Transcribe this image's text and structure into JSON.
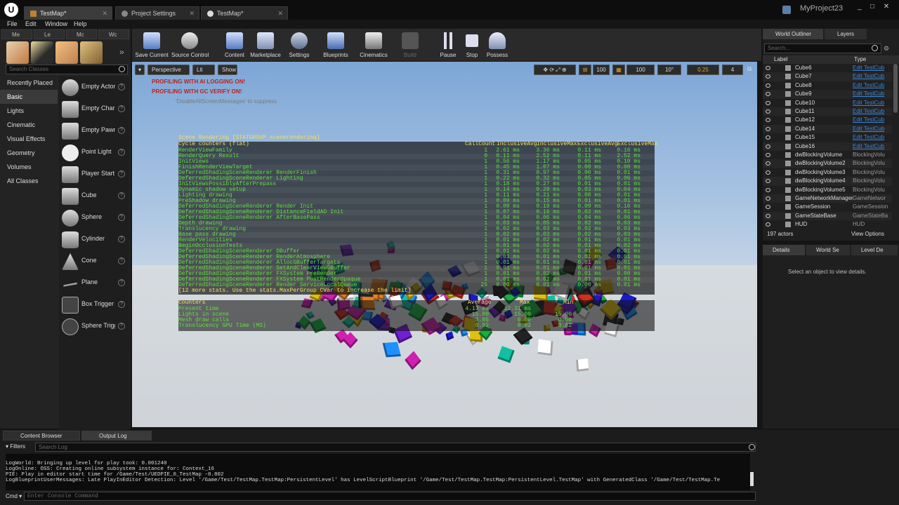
{
  "window": {
    "logo": "U",
    "tabs": [
      "TestMap*",
      "Project Settings",
      "TestMap*"
    ],
    "project_name": "MyProject23",
    "controls": [
      "_",
      "□",
      "✕"
    ]
  },
  "menu": [
    "File",
    "Edit",
    "Window",
    "Help"
  ],
  "modes": {
    "tabs": [
      "Me",
      "Le",
      "Mc",
      "Wc"
    ],
    "search_placeholder": "Search Classes",
    "categories": [
      "Recently Placed",
      "Basic",
      "Lights",
      "Cinematic",
      "Visual Effects",
      "Geometry",
      "Volumes",
      "All Classes"
    ],
    "actors": [
      "Empty Actor",
      "Empty Chara",
      "Empty Pawn",
      "Point Light",
      "Player Start",
      "Cube",
      "Sphere",
      "Cylinder",
      "Cone",
      "Plane",
      "Box Trigger",
      "Sphere Trigg"
    ]
  },
  "toolbar": {
    "buttons": [
      "Save Current",
      "Source Control",
      "Content",
      "Marketplace",
      "Settings",
      "Blueprints",
      "Cinematics",
      "Build",
      "Pause",
      "Stop",
      "Possess"
    ]
  },
  "viewport": {
    "perspective": "Perspective",
    "lit": "Lit",
    "show": "Show",
    "snap_values": [
      "100",
      "100",
      "10°",
      "0.25",
      "4"
    ],
    "warnings": [
      "PROFILING WITH AI LOGGING ON!",
      "PROFILING WITH GC VERIFY ON!"
    ],
    "hint": "'DisableAllScreenMessages' to suppress",
    "stats": {
      "group_title": "Scene Rendering [STATGROUP_scenerendering]",
      "section": "Cycle counters (flat)",
      "columns": [
        "CallCount",
        "InclusiveAvg",
        "InclusiveMax",
        "ExclusiveAvg",
        "ExclusiveMax"
      ],
      "rows": [
        [
          "RenderViewFamily",
          "1",
          "2.61 ms",
          "3.36 ms",
          "0.11 ms",
          "0.16 ms"
        ],
        [
          "RenderQuery Result",
          "0",
          "0.11 ms",
          "2.52 ms",
          "0.11 ms",
          "2.52 ms"
        ],
        [
          "InitViews",
          "1",
          "0.56 ms",
          "1.17 ms",
          "0.05 ms",
          "0.10 ms"
        ],
        [
          "FinishRenderViewTarget",
          "1",
          "0.45 ms",
          "1.07 ms",
          "0.00 ms",
          "0.00 ms"
        ],
        [
          "DeferredShadingSceneRenderer RenderFinish",
          "1",
          "0.31 ms",
          "0.97 ms",
          "0.00 ms",
          "0.01 ms"
        ],
        [
          "DeferredShadingSceneRenderer Lighting",
          "1",
          "0.22 ms",
          "0.32 ms",
          "0.05 ms",
          "0.06 ms"
        ],
        [
          "InitViewsPossiblyAfterPrepass",
          "1",
          "0.18 ms",
          "0.27 ms",
          "0.01 ms",
          "0.01 ms"
        ],
        [
          "Dynamic shadow setup",
          "1",
          "0.14 ms",
          "0.29 ms",
          "0.03 ms",
          "0.04 ms"
        ],
        [
          "Lighting drawing",
          "1",
          "0.11 ms",
          "0.21 ms",
          "0.00 ms",
          "0.01 ms"
        ],
        [
          "PreShadow drawing",
          "1",
          "0.09 ms",
          "0.15 ms",
          "0.01 ms",
          "0.01 ms"
        ],
        [
          "DeferredShadingSceneRenderer Render Init",
          "1",
          "0.09 ms",
          "0.19 ms",
          "0.09 ms",
          "0.16 ms"
        ],
        [
          "DeferredShadingSceneRenderer DistanceFieldAO Init",
          "1",
          "0.07 ms",
          "0.16 ms",
          "0.02 ms",
          "0.01 ms"
        ],
        [
          "DeferredShadingSceneRenderer AfterBasePass",
          "1",
          "0.04 ms",
          "0.06 ms",
          "0.04 ms",
          "0.06 ms"
        ],
        [
          "Depth drawing",
          "1",
          "0.03 ms",
          "0.05 ms",
          "0.02 ms",
          "0.03 ms"
        ],
        [
          "Translucency drawing",
          "1",
          "0.02 ms",
          "0.03 ms",
          "0.02 ms",
          "0.03 ms"
        ],
        [
          "Base pass drawing",
          "1",
          "0.02 ms",
          "0.03 ms",
          "0.02 ms",
          "0.03 ms"
        ],
        [
          "RenderVelocities",
          "1",
          "0.01 ms",
          "0.02 ms",
          "0.01 ms",
          "0.01 ms"
        ],
        [
          "BeginOcclusionTests",
          "1",
          "0.01 ms",
          "0.02 ms",
          "0.01 ms",
          "0.02 ms"
        ],
        [
          "DeferredShadingSceneRenderer DBuffer",
          "1",
          "0.01 ms",
          "0.02 ms",
          "0.01 ms",
          "0.01 ms"
        ],
        [
          "DeferredShadingSceneRenderer RenderAtmosphere",
          "1",
          "0.01 ms",
          "0.01 ms",
          "0.01 ms",
          "0.01 ms"
        ],
        [
          "DeferredShadingSceneRenderer AllocGBufferTargets",
          "1",
          "0.01 ms",
          "0.01 ms",
          "0.01 ms",
          "0.01 ms"
        ],
        [
          "DeferredShadingSceneRenderer SetAndClearViewGBuffer",
          "1",
          "0.01 ms",
          "0.01 ms",
          "0.01 ms",
          "0.01 ms"
        ],
        [
          "DeferredShadingSceneRenderer FXSystem PreRender",
          "1",
          "0.01 ms",
          "0.02 ms",
          "0.01 ms",
          "0.00 ms"
        ],
        [
          "DeferredShadingSceneRenderer FXSystem PostRenderOpaque",
          "1",
          "0.01 ms",
          "0.01 ms",
          "0.01 ms",
          "0.01 ms"
        ],
        [
          "DeferredShadingSceneRenderer Render ServiceLocalQueue",
          "25",
          "0.00 ms",
          "0.01 ms",
          "0.00 ms",
          "0.01 ms"
        ]
      ],
      "footer": "[12 more stats. Use the stats.MaxPerGroup CVar to increase the limit]",
      "counters": {
        "title": "Counters",
        "columns": [
          "Average",
          "Max",
          "Min"
        ],
        "rows": [
          [
            "Present time",
            "4.13 ms",
            "12.31 ms",
            ""
          ],
          [
            "Lights in scene",
            "15.00",
            "15.00",
            "15.00"
          ],
          [
            "Mesh draw calls",
            "3.05",
            "6.00",
            "0.00"
          ],
          [
            "Translucency GPU Time (MS)",
            "0.02",
            "0.02",
            "0.02"
          ]
        ]
      }
    }
  },
  "outliner": {
    "tabs": [
      "World Outliner",
      "Layers"
    ],
    "search_placeholder": "Search...",
    "columns": [
      "Label",
      "Type"
    ],
    "rows": [
      [
        "Cube6",
        "Edit TestCub"
      ],
      [
        "Cube7",
        "Edit TestCub"
      ],
      [
        "Cube8",
        "Edit TestCub"
      ],
      [
        "Cube9",
        "Edit TestCub"
      ],
      [
        "Cube10",
        "Edit TestCub"
      ],
      [
        "Cube11",
        "Edit TestCub"
      ],
      [
        "Cube12",
        "Edit TestCub"
      ],
      [
        "Cube14",
        "Edit TestCub"
      ],
      [
        "Cube15",
        "Edit TestCub"
      ],
      [
        "Cube16",
        "Edit TestCub"
      ],
      [
        "dwBlockingVolume",
        "BlockingVolu"
      ],
      [
        "dwBlockingVolume2",
        "BlockingVolu"
      ],
      [
        "dwBlockingVolume3",
        "BlockingVolu"
      ],
      [
        "dwBlockingVolume4",
        "BlockingVolu"
      ],
      [
        "dwBlockingVolume5",
        "BlockingVolu"
      ],
      [
        "GameNetworkManager",
        "GameNetwor"
      ],
      [
        "GameSession",
        "GameSession"
      ],
      [
        "GameStateBase",
        "GameStateBa"
      ],
      [
        "HUD",
        "HUD"
      ]
    ],
    "count": "197 actors",
    "view_options": "View Options"
  },
  "details": {
    "tabs": [
      "Details",
      "World Se",
      "Level De"
    ],
    "empty_message": "Select an object to view details."
  },
  "bottom": {
    "tabs": [
      "Content Browser",
      "Output Log"
    ],
    "filters": "Filters",
    "search_placeholder": "Search Log",
    "log": [
      "LogWorld: Bringing up level for play took: 0.001240",
      "LogOnline: OSS: Creating online subsystem instance for: Context_16",
      "PIE: Play in editor start time for /Game/Test/UEDPIE_0_TestMap -0.802",
      "LogBlueprintUserMessages: Late PlayInEditor Detection: Level '/Game/Test/TestMap.TestMap:PersistentLevel' has LevelScriptBlueprint '/Game/Test/TestMap.TestMap:PersistentLevel.TestMap' with GeneratedClass '/Game/Test/TestMap.Te"
    ],
    "cmd_label": "Cmd",
    "cmd_placeholder": "Enter Console Command"
  },
  "colors": {
    "accent": "#3a86d8",
    "stat_green": "#5fe040",
    "stat_yellow": "#f0e060",
    "warning_red": "#c02020"
  }
}
